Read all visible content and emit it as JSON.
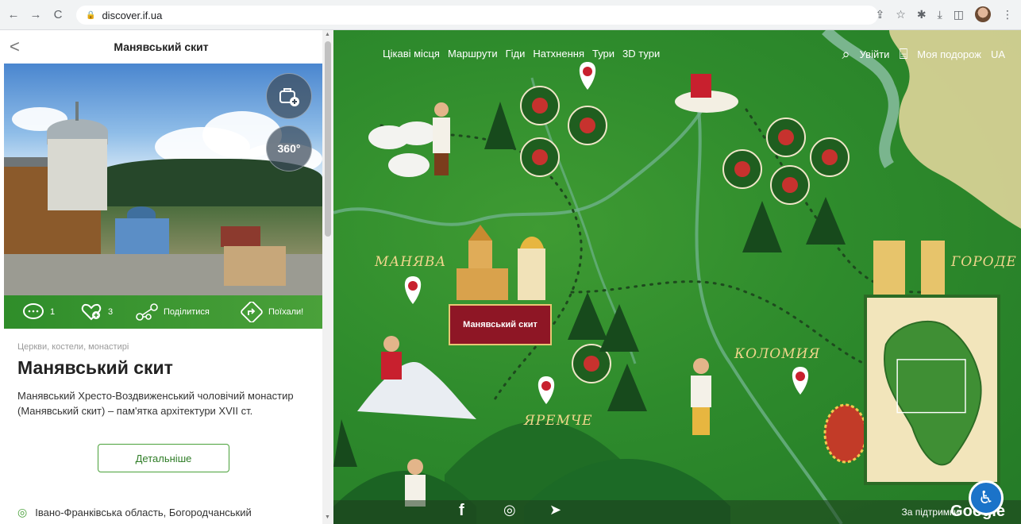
{
  "browser": {
    "url": "discover.if.ua",
    "back_icon": "←",
    "forward_icon": "→",
    "reload_icon": "C"
  },
  "panel": {
    "header_title": "Манявський скит",
    "back_icon": "<",
    "badge_360": "360°",
    "actions": {
      "comments_count": "1",
      "likes_count": "3",
      "share_label": "Поділитися",
      "go_label": "Поїхали!"
    },
    "category": "Церкви, костели, монастирі",
    "title": "Манявський скит",
    "description": "Манявський Хресто-Воздвиженський чоловічий монастир (Манявський скит) – пам'ятка архітектури XVII ст.",
    "details_button": "Детальніше",
    "address": "Івано-Франківська область, Богородчанський"
  },
  "map": {
    "nav": [
      "Цікаві місця",
      "Маршрути",
      "Гіди",
      "Натхнення",
      "Тури",
      "3D тури"
    ],
    "login": "Увійти",
    "my_trip": "Моя подорож",
    "lang": "UA",
    "cities": {
      "manyava": "МАНЯВА",
      "yaremche": "ЯРЕМЧЕ",
      "kolomyia": "КОЛОМИЯ",
      "horodenka": "ГОРОДЕ"
    },
    "selected_label": "Манявський скит",
    "support": "За підтримки",
    "google": "Google",
    "facebook_icon": "f",
    "accent": "#8e1625"
  }
}
